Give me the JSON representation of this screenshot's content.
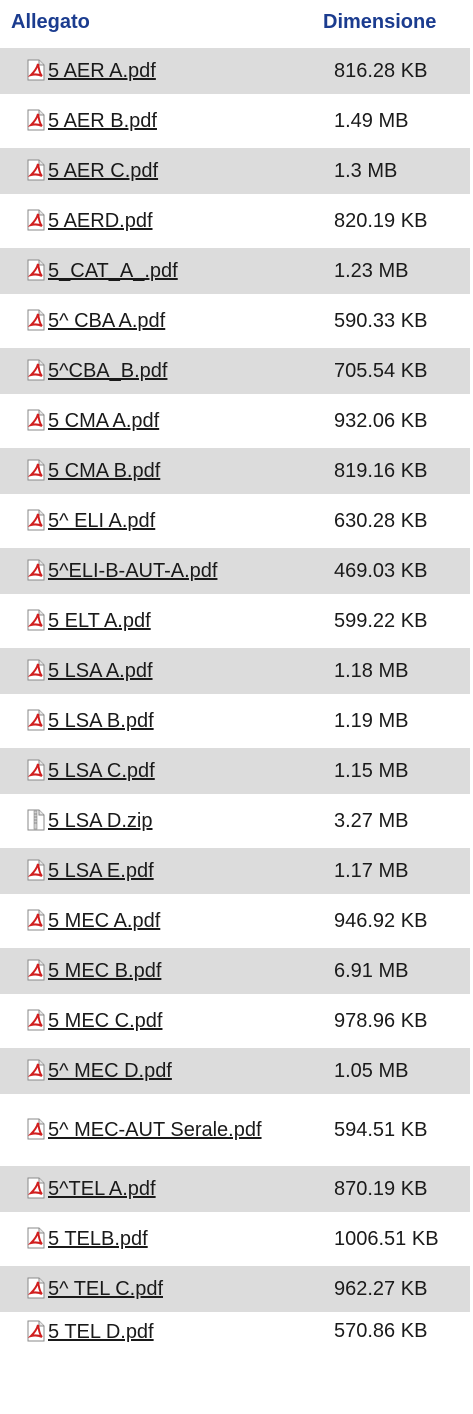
{
  "table": {
    "header_file": "Allegato",
    "header_size": "Dimensione"
  },
  "files": [
    {
      "name": "5 AER A.pdf",
      "size": "816.28 KB",
      "icon": "pdf-icon"
    },
    {
      "name": "5 AER B.pdf",
      "size": "1.49 MB",
      "icon": "pdf-icon"
    },
    {
      "name": "5 AER C.pdf",
      "size": "1.3 MB",
      "icon": "pdf-icon"
    },
    {
      "name": "5 AERD.pdf",
      "size": "820.19 KB",
      "icon": "pdf-icon"
    },
    {
      "name": "5_CAT_A_.pdf",
      "size": "1.23 MB",
      "icon": "pdf-icon"
    },
    {
      "name": "5^ CBA A.pdf",
      "size": "590.33 KB",
      "icon": "pdf-icon"
    },
    {
      "name": "5^CBA_B.pdf",
      "size": "705.54 KB",
      "icon": "pdf-icon"
    },
    {
      "name": "5 CMA A.pdf",
      "size": "932.06 KB",
      "icon": "pdf-icon"
    },
    {
      "name": "5 CMA B.pdf",
      "size": "819.16 KB",
      "icon": "pdf-icon"
    },
    {
      "name": "5^ ELI A.pdf",
      "size": "630.28 KB",
      "icon": "pdf-icon"
    },
    {
      "name": "5^ELI-B-AUT-A.pdf",
      "size": "469.03 KB",
      "icon": "pdf-icon"
    },
    {
      "name": "5 ELT A.pdf",
      "size": "599.22 KB",
      "icon": "pdf-icon"
    },
    {
      "name": "5 LSA A.pdf",
      "size": "1.18 MB",
      "icon": "pdf-icon"
    },
    {
      "name": "5 LSA B.pdf",
      "size": "1.19 MB",
      "icon": "pdf-icon"
    },
    {
      "name": "5 LSA C.pdf",
      "size": "1.15 MB",
      "icon": "pdf-icon"
    },
    {
      "name": "5 LSA D.zip",
      "size": "3.27 MB",
      "icon": "zip-icon"
    },
    {
      "name": "5 LSA E.pdf",
      "size": "1.17 MB",
      "icon": "pdf-icon"
    },
    {
      "name": "5 MEC A.pdf",
      "size": "946.92 KB",
      "icon": "pdf-icon"
    },
    {
      "name": "5 MEC B.pdf",
      "size": "6.91 MB",
      "icon": "pdf-icon"
    },
    {
      "name": "5 MEC C.pdf",
      "size": "978.96 KB",
      "icon": "pdf-icon"
    },
    {
      "name": "5^ MEC D.pdf",
      "size": "1.05 MB",
      "icon": "pdf-icon"
    },
    {
      "name": "5^ MEC-AUT Serale.pdf",
      "size": "594.51 KB",
      "icon": "pdf-icon"
    },
    {
      "name": "5^TEL A.pdf",
      "size": "870.19 KB",
      "icon": "pdf-icon"
    },
    {
      "name": "5 TELB.pdf",
      "size": "1006.51 KB",
      "icon": "pdf-icon"
    },
    {
      "name": "5^ TEL C.pdf",
      "size": "962.27 KB",
      "icon": "pdf-icon"
    },
    {
      "name": "5 TEL D.pdf",
      "size": "570.86 KB",
      "icon": "pdf-icon"
    }
  ],
  "colors": {
    "header_text": "#1b3c8f",
    "row_shade": "#dcdcdc",
    "pdf_icon_red": "#d11f1f"
  }
}
